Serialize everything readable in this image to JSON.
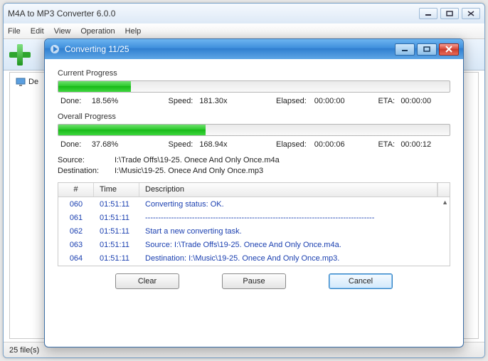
{
  "main": {
    "title": "M4A to MP3 Converter 6.0.0",
    "menu": {
      "file": "File",
      "edit": "Edit",
      "view": "View",
      "operation": "Operation",
      "help": "Help"
    },
    "list_item_prefix": "De",
    "status": "25 file(s)"
  },
  "dialog": {
    "title": "Converting 11/25",
    "current": {
      "label": "Current Progress",
      "percent": 18.56,
      "done_label": "Done:",
      "done": "18.56%",
      "speed_label": "Speed:",
      "speed": "181.30x",
      "elapsed_label": "Elapsed:",
      "elapsed": "00:00:00",
      "eta_label": "ETA:",
      "eta": "00:00:00"
    },
    "overall": {
      "label": "Overall Progress",
      "percent": 37.68,
      "done_label": "Done:",
      "done": "37.68%",
      "speed_label": "Speed:",
      "speed": "168.94x",
      "elapsed_label": "Elapsed:",
      "elapsed": "00:00:06",
      "eta_label": "ETA:",
      "eta": "00:00:12"
    },
    "source_label": "Source:",
    "source": "I:\\Trade Offs\\19-25. Onece And Only Once.m4a",
    "dest_label": "Destination:",
    "dest": "I:\\Music\\19-25. Onece And Only Once.mp3",
    "columns": {
      "n": "#",
      "time": "Time",
      "desc": "Description"
    },
    "rows": [
      {
        "n": "060",
        "t": "01:51:11",
        "d": "Converting status: OK."
      },
      {
        "n": "061",
        "t": "01:51:11",
        "d": "----------------------------------------------------------------------------------------"
      },
      {
        "n": "062",
        "t": "01:51:11",
        "d": "Start a new converting task."
      },
      {
        "n": "063",
        "t": "01:51:11",
        "d": "Source:  I:\\Trade Offs\\19-25. Onece And Only Once.m4a."
      },
      {
        "n": "064",
        "t": "01:51:11",
        "d": "Destination: I:\\Music\\19-25. Onece And Only Once.mp3."
      }
    ],
    "buttons": {
      "clear": "Clear",
      "pause": "Pause",
      "cancel": "Cancel"
    }
  }
}
